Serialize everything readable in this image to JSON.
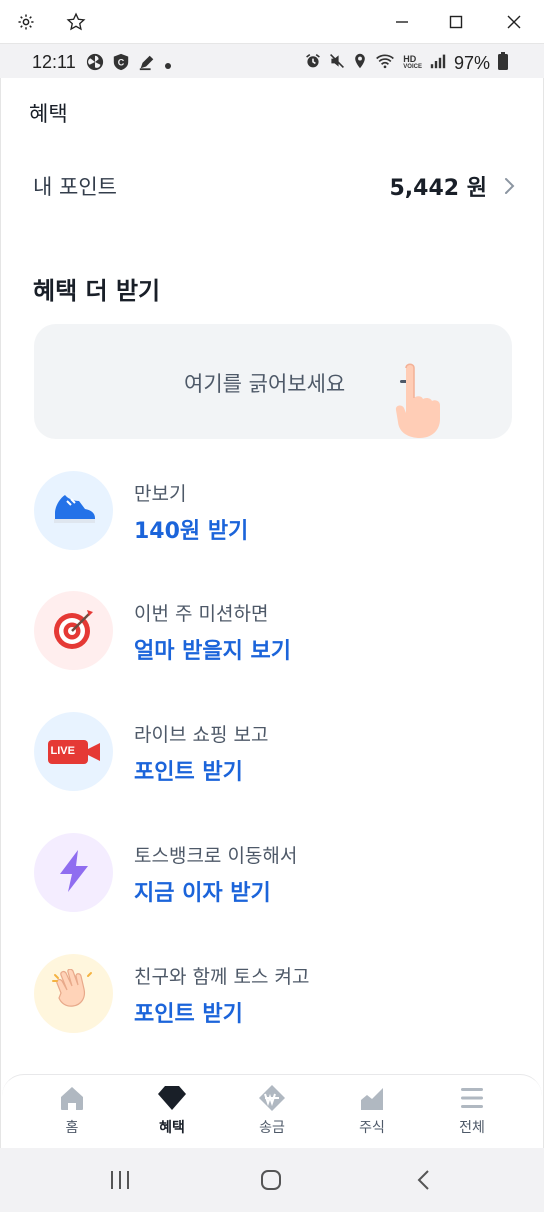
{
  "window": {
    "settings_icon": "gear-icon",
    "star_icon": "star-icon",
    "minimize_icon": "minimize-icon",
    "maximize_icon": "maximize-icon",
    "close_icon": "close-icon"
  },
  "status_bar": {
    "time": "12:11",
    "battery": "97%",
    "left_icons": [
      "fan-icon",
      "c-circle-icon",
      "pen-icon",
      "dot-icon"
    ],
    "right_icons": [
      "alarm-icon",
      "mute-icon",
      "location-icon",
      "wifi-icon",
      "hd-voice-icon",
      "signal-icon",
      "battery-icon"
    ],
    "hd_text": "HD",
    "voice_text": "VOICE"
  },
  "header": {
    "title": "혜택"
  },
  "points": {
    "label": "내 포인트",
    "value": "5,442 원"
  },
  "section": {
    "title": "혜택 더 받기"
  },
  "scratch": {
    "text": "여기를 긁어보세요"
  },
  "items": [
    {
      "sub": "만보기",
      "cta": "140원 받기",
      "icon": "shoe-icon",
      "bg": "#e8f3ff"
    },
    {
      "sub": "이번 주 미션하면",
      "cta": "얼마 받을지 보기",
      "icon": "target-icon",
      "bg": "#ffeeee"
    },
    {
      "sub": "라이브 쇼핑 보고",
      "cta": "포인트 받기",
      "icon": "live-camera-icon",
      "bg": "#e8f3ff",
      "live_text": "LIVE"
    },
    {
      "sub": "토스뱅크로 이동해서",
      "cta": "지금 이자 받기",
      "icon": "lightning-icon",
      "bg": "#f4edff"
    },
    {
      "sub": "친구와 함께 토스 켜고",
      "cta": "포인트 받기",
      "icon": "waving-hand-icon",
      "bg": "#fff6dd"
    }
  ],
  "nav": [
    {
      "label": "홈",
      "icon": "home-icon",
      "active": false
    },
    {
      "label": "혜택",
      "icon": "diamond-icon",
      "active": true
    },
    {
      "label": "송금",
      "icon": "won-icon",
      "active": false
    },
    {
      "label": "주식",
      "icon": "chart-icon",
      "active": false
    },
    {
      "label": "전체",
      "icon": "menu-icon",
      "active": false
    }
  ],
  "system_nav": {
    "recents_icon": "recents-icon",
    "home_icon": "home-circle-icon",
    "back_icon": "back-icon"
  },
  "colors": {
    "accent": "#1b64da",
    "title": "#191f28",
    "sub": "#4e5968"
  }
}
